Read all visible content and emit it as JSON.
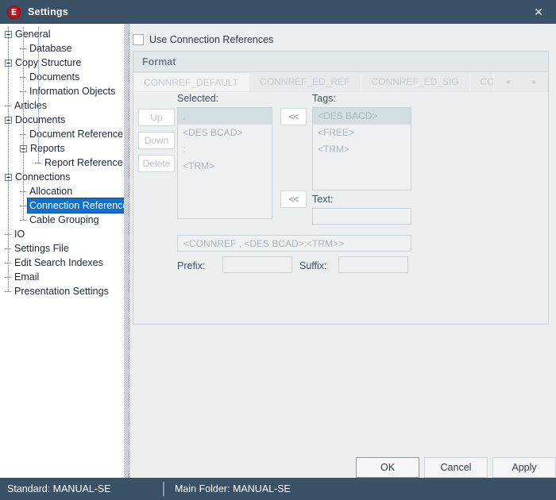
{
  "window": {
    "title": "Settings",
    "logo_letter": "E",
    "close_label": "✕"
  },
  "tree": {
    "nodes": [
      {
        "label": "General",
        "depth": 0,
        "expandable": true,
        "expanded": true,
        "selected": false
      },
      {
        "label": "Database",
        "depth": 1,
        "expandable": false,
        "expanded": false,
        "selected": false
      },
      {
        "label": "Copy Structure",
        "depth": 0,
        "expandable": true,
        "expanded": true,
        "selected": false
      },
      {
        "label": "Documents",
        "depth": 1,
        "expandable": false,
        "expanded": false,
        "selected": false
      },
      {
        "label": "Information Objects",
        "depth": 1,
        "expandable": false,
        "expanded": false,
        "selected": false
      },
      {
        "label": "Articles",
        "depth": 0,
        "expandable": false,
        "expanded": false,
        "selected": false
      },
      {
        "label": "Documents",
        "depth": 0,
        "expandable": true,
        "expanded": true,
        "selected": false
      },
      {
        "label": "Document Reference",
        "depth": 1,
        "expandable": false,
        "expanded": false,
        "selected": false
      },
      {
        "label": "Reports",
        "depth": 1,
        "expandable": true,
        "expanded": true,
        "selected": false
      },
      {
        "label": "Report Reference",
        "depth": 2,
        "expandable": false,
        "expanded": false,
        "selected": false
      },
      {
        "label": "Connections",
        "depth": 0,
        "expandable": true,
        "expanded": true,
        "selected": false
      },
      {
        "label": "Allocation",
        "depth": 1,
        "expandable": false,
        "expanded": false,
        "selected": false
      },
      {
        "label": "Connection Reference",
        "depth": 1,
        "expandable": false,
        "expanded": false,
        "selected": true
      },
      {
        "label": "Cable Grouping",
        "depth": 1,
        "expandable": false,
        "expanded": false,
        "selected": false
      },
      {
        "label": "IO",
        "depth": 0,
        "expandable": false,
        "expanded": false,
        "selected": false
      },
      {
        "label": "Settings File",
        "depth": 0,
        "expandable": false,
        "expanded": false,
        "selected": false
      },
      {
        "label": "Edit Search Indexes",
        "depth": 0,
        "expandable": false,
        "expanded": false,
        "selected": false
      },
      {
        "label": "Email",
        "depth": 0,
        "expandable": false,
        "expanded": false,
        "selected": false
      },
      {
        "label": "Presentation Settings",
        "depth": 0,
        "expandable": false,
        "expanded": false,
        "selected": false
      }
    ]
  },
  "main": {
    "use_connection_references": {
      "label": "Use Connection References",
      "checked": false
    },
    "format_panel": {
      "title": "Format",
      "tabs": [
        {
          "label": "CONNREF_DEFAULT",
          "active": true,
          "enabled": false
        },
        {
          "label": "CONNREF_ED_REF",
          "active": false,
          "enabled": false
        },
        {
          "label": "CONNREF_ED_SIG",
          "active": false,
          "enabled": false
        },
        {
          "label": "CONNREF_ED_SIGS",
          "active": false,
          "enabled": false
        }
      ],
      "tab_nav": {
        "prev": "◄",
        "next": "►"
      },
      "buttons": {
        "up": "Up",
        "down": "Down",
        "delete": "Delete",
        "move_tag": "<<",
        "move_text": "<<"
      },
      "selected_label": "Selected:",
      "selected_items": [
        {
          "value": ",",
          "selected": true
        },
        {
          "value": "<DES BCAD>",
          "selected": false
        },
        {
          "value": ":",
          "selected": false
        },
        {
          "value": "<TRM>",
          "selected": false
        }
      ],
      "tags_label": "Tags:",
      "tags_items": [
        {
          "value": "<DES BACD>",
          "selected": true
        },
        {
          "value": "<FREE>",
          "selected": false
        },
        {
          "value": "<TRM>",
          "selected": false
        }
      ],
      "text_label": "Text:",
      "text_value": "",
      "text_placeholder": "",
      "preview_value": "<CONNREF , <DES BCAD>:<TRM>>",
      "prefix_label": "Prefix:",
      "prefix_value": "",
      "suffix_label": "Suffix:",
      "suffix_value": ""
    },
    "dialog_buttons": {
      "ok": "OK",
      "cancel": "Cancel",
      "apply": "Apply"
    }
  },
  "statusbar": {
    "standard": "Standard: MANUAL-SE",
    "main_folder": "Main Folder: MANUAL-SE"
  },
  "colors": {
    "titlebar": "#3b5166",
    "accent_selection": "#1070d0",
    "logo_red": "#c5101b",
    "panel_bg": "#eceff0"
  }
}
